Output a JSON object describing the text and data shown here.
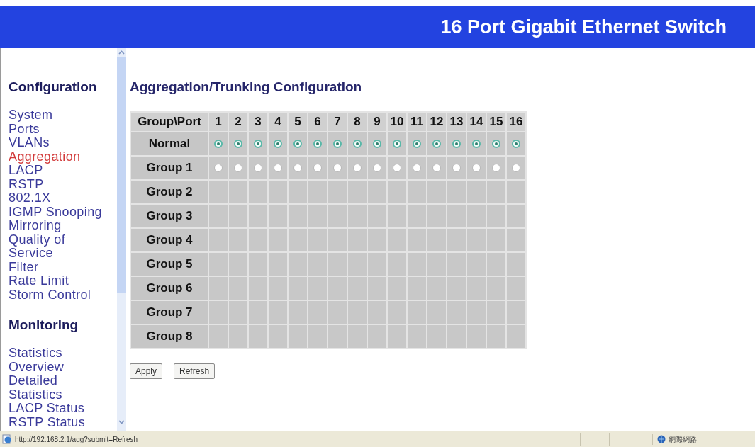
{
  "header": {
    "title": "16 Port Gigabit Ethernet Switch"
  },
  "sidebar": {
    "sections": [
      {
        "title": "Configuration",
        "items": [
          {
            "label": "System",
            "selected": false
          },
          {
            "label": "Ports",
            "selected": false
          },
          {
            "label": "VLANs",
            "selected": false
          },
          {
            "label": "Aggregation",
            "selected": true
          },
          {
            "label": "LACP",
            "selected": false
          },
          {
            "label": "RSTP",
            "selected": false
          },
          {
            "label": "802.1X",
            "selected": false
          },
          {
            "label": "IGMP Snooping",
            "selected": false
          },
          {
            "label": "Mirroring",
            "selected": false
          },
          {
            "label": "Quality of Service",
            "selected": false
          },
          {
            "label": "Filter",
            "selected": false
          },
          {
            "label": "Rate Limit",
            "selected": false
          },
          {
            "label": "Storm Control",
            "selected": false
          }
        ]
      },
      {
        "title": "Monitoring",
        "items": [
          {
            "label": "Statistics Overview",
            "selected": false
          },
          {
            "label": "Detailed Statistics",
            "selected": false
          },
          {
            "label": "LACP Status",
            "selected": false
          },
          {
            "label": "RSTP Status",
            "selected": false
          }
        ]
      }
    ]
  },
  "content": {
    "title": "Aggregation/Trunking Configuration",
    "table": {
      "corner": "Group\\Port",
      "columns": [
        "1",
        "2",
        "3",
        "4",
        "5",
        "6",
        "7",
        "8",
        "9",
        "10",
        "11",
        "12",
        "13",
        "14",
        "15",
        "16"
      ],
      "rows": [
        {
          "label": "Normal",
          "kind": "radio",
          "cells": [
            {
              "selected": true
            },
            {
              "selected": true
            },
            {
              "selected": true
            },
            {
              "selected": true
            },
            {
              "selected": true
            },
            {
              "selected": true
            },
            {
              "selected": true
            },
            {
              "selected": true
            },
            {
              "selected": true
            },
            {
              "selected": true
            },
            {
              "selected": true
            },
            {
              "selected": true
            },
            {
              "selected": true
            },
            {
              "selected": true
            },
            {
              "selected": true
            },
            {
              "selected": true
            }
          ]
        },
        {
          "label": "Group 1",
          "kind": "radio",
          "cells": [
            {
              "selected": false
            },
            {
              "selected": false
            },
            {
              "selected": false
            },
            {
              "selected": false
            },
            {
              "selected": false
            },
            {
              "selected": false
            },
            {
              "selected": false
            },
            {
              "selected": false
            },
            {
              "selected": false
            },
            {
              "selected": false
            },
            {
              "selected": false
            },
            {
              "selected": false
            },
            {
              "selected": false
            },
            {
              "selected": false
            },
            {
              "selected": false
            },
            {
              "selected": false
            }
          ]
        },
        {
          "label": "Group 2",
          "kind": "empty"
        },
        {
          "label": "Group 3",
          "kind": "empty"
        },
        {
          "label": "Group 4",
          "kind": "empty"
        },
        {
          "label": "Group 5",
          "kind": "empty"
        },
        {
          "label": "Group 6",
          "kind": "empty"
        },
        {
          "label": "Group 7",
          "kind": "empty"
        },
        {
          "label": "Group 8",
          "kind": "empty"
        }
      ]
    },
    "buttons": [
      "Apply",
      "Refresh"
    ]
  },
  "status_bar": {
    "url": "http://192.168.2.1/agg?submit=Refresh",
    "zone": "網際網路"
  }
}
